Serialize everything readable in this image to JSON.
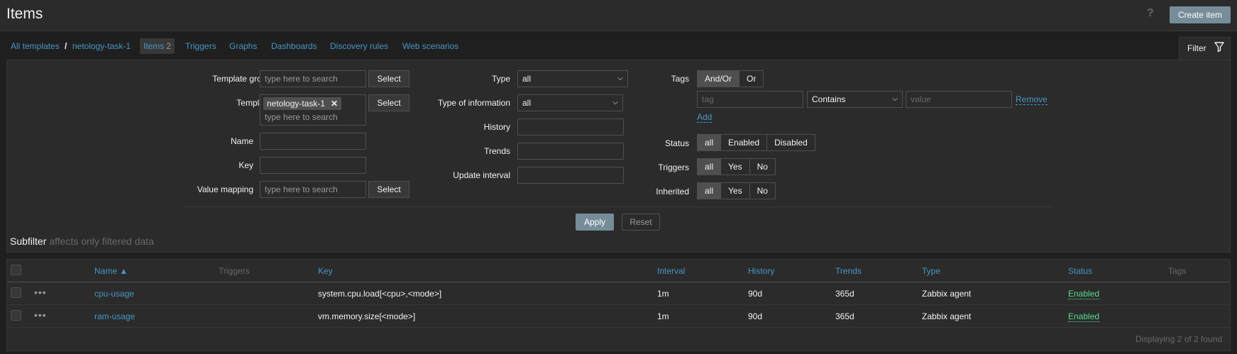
{
  "header": {
    "title": "Items",
    "help_label": "?",
    "create_label": "Create item"
  },
  "nav": {
    "all_templates": "All templates",
    "separator": "/",
    "template_name": "netology-task-1",
    "items_label": "Items",
    "items_count": "2",
    "triggers": "Triggers",
    "graphs": "Graphs",
    "dashboards": "Dashboards",
    "discovery_rules": "Discovery rules",
    "web_scenarios": "Web scenarios"
  },
  "filter_tab": {
    "label": "Filter",
    "icon": "funnel-icon"
  },
  "filter": {
    "template_groups": {
      "label": "Template groups",
      "placeholder": "type here to search",
      "button": "Select"
    },
    "templates": {
      "label": "Templates",
      "chip": "netology-task-1",
      "chip_remove": "✕",
      "placeholder": "type here to search",
      "button": "Select"
    },
    "name": {
      "label": "Name",
      "value": ""
    },
    "key": {
      "label": "Key",
      "value": ""
    },
    "value_mapping": {
      "label": "Value mapping",
      "placeholder": "type here to search",
      "button": "Select"
    },
    "type": {
      "label": "Type",
      "value": "all"
    },
    "type_of_information": {
      "label": "Type of information",
      "value": "all"
    },
    "history": {
      "label": "History",
      "value": ""
    },
    "trends": {
      "label": "Trends",
      "value": ""
    },
    "update_interval": {
      "label": "Update interval",
      "value": ""
    },
    "tags": {
      "label": "Tags",
      "and_or": "And/Or",
      "or": "Or",
      "tag_placeholder": "tag",
      "operator": "Contains",
      "value_placeholder": "value",
      "remove": "Remove",
      "add": "Add"
    },
    "status": {
      "label": "Status",
      "options": [
        "all",
        "Enabled",
        "Disabled"
      ]
    },
    "triggers": {
      "label": "Triggers",
      "options": [
        "all",
        "Yes",
        "No"
      ]
    },
    "inherited": {
      "label": "Inherited",
      "options": [
        "all",
        "Yes",
        "No"
      ]
    },
    "apply": "Apply",
    "reset": "Reset"
  },
  "subfilter": {
    "title": "Subfilter",
    "note": "affects only filtered data"
  },
  "table": {
    "columns": {
      "name": "Name ▲",
      "triggers": "Triggers",
      "key": "Key",
      "interval": "Interval",
      "history": "History",
      "trends": "Trends",
      "type": "Type",
      "status": "Status",
      "tags": "Tags"
    },
    "rows": [
      {
        "menu": "•••",
        "name": "cpu-usage",
        "key": "system.cpu.load[<cpu>,<mode>]",
        "interval": "1m",
        "history": "90d",
        "trends": "365d",
        "type": "Zabbix agent",
        "status": "Enabled"
      },
      {
        "menu": "•••",
        "name": "ram-usage",
        "key": "vm.memory.size[<mode>]",
        "interval": "1m",
        "history": "90d",
        "trends": "365d",
        "type": "Zabbix agent",
        "status": "Enabled"
      }
    ],
    "footer": "Displaying 2 of 2 found"
  }
}
